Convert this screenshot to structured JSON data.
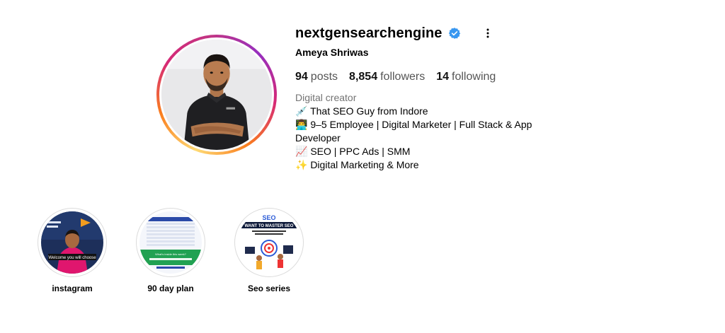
{
  "profile": {
    "username": "nextgensearchengine",
    "full_name": "Ameya Shriwas",
    "verified": true,
    "verified_color": "#3897f0",
    "ring_colors": [
      "#feda75",
      "#fa7e1e",
      "#d62976",
      "#962fbf"
    ]
  },
  "stats": {
    "posts_count": "94",
    "posts_label": "posts",
    "followers_count": "8,854",
    "followers_label": "followers",
    "following_count": "14",
    "following_label": "following"
  },
  "bio": {
    "category": "Digital creator",
    "lines": [
      "💉 That SEO Guy from Indore",
      "👨‍💻 9–5 Employee | Digital Marketer | Full Stack & App Developer",
      "📈 SEO | PPC Ads | SMM",
      "✨ Digital Marketing & More"
    ]
  },
  "highlights": [
    {
      "label": "instagram",
      "caption": "Welcome you will choose"
    },
    {
      "label": "90 day plan",
      "caption": "What's inside this week?"
    },
    {
      "label": "Seo series",
      "caption_title": "SEO",
      "caption": "WANT TO MASTER SEO"
    }
  ]
}
